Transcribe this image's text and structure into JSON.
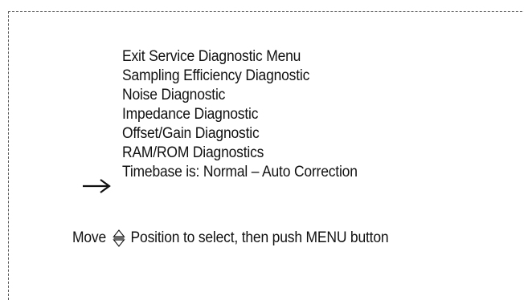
{
  "menu": {
    "items": [
      {
        "label": "Exit Service Diagnostic Menu",
        "selected": false
      },
      {
        "label": "Sampling Efficiency Diagnostic",
        "selected": false
      },
      {
        "label": "Noise Diagnostic",
        "selected": false
      },
      {
        "label": "Impedance Diagnostic",
        "selected": false
      },
      {
        "label": "Offset/Gain Diagnostic",
        "selected": false
      },
      {
        "label": "RAM/ROM Diagnostics",
        "selected": true
      },
      {
        "label": "Timebase is: Normal – Auto Correction",
        "selected": false
      }
    ],
    "selector_icon": "right-arrow-icon"
  },
  "instruction": {
    "prefix": "Move",
    "icon": "up-down-triangle-icon",
    "suffix": "Position to select, then push MENU button"
  },
  "colors": {
    "text": "#111111",
    "frame": "#555555",
    "background": "#ffffff"
  }
}
